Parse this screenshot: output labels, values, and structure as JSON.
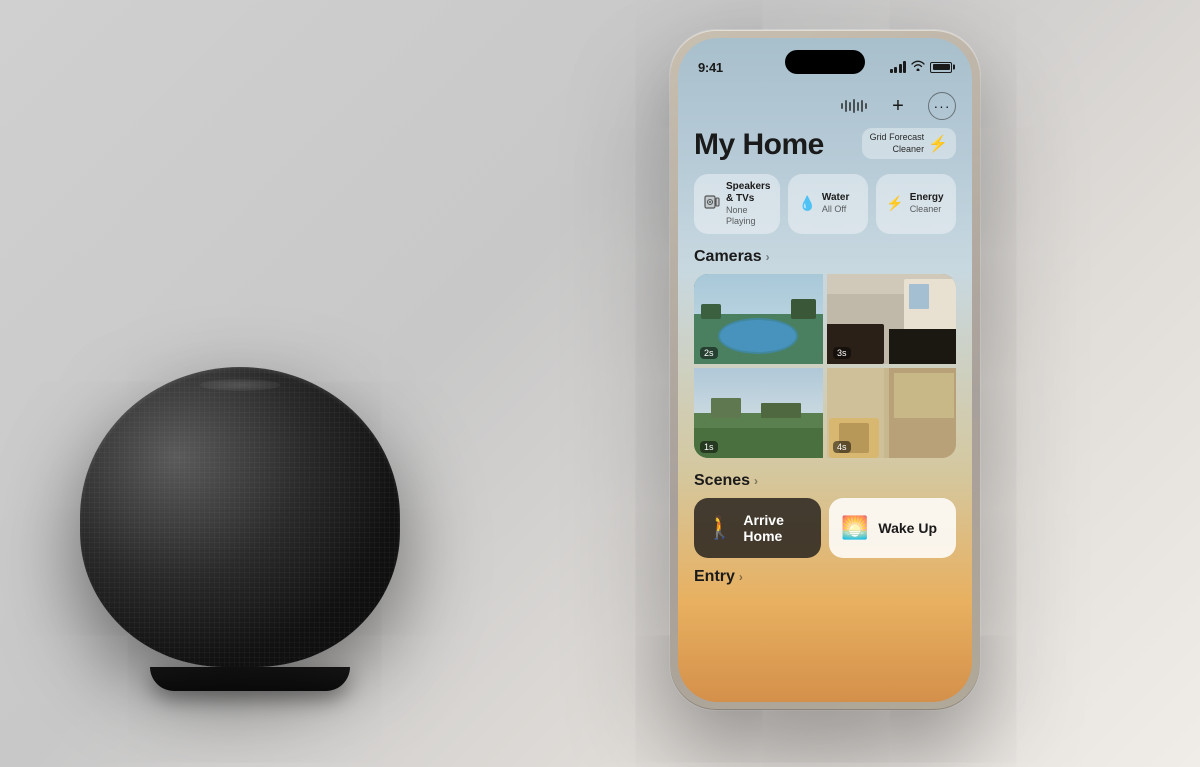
{
  "page": {
    "bg_description": "light gray gradient background"
  },
  "status_bar": {
    "time": "9:41",
    "signal_label": "signal",
    "wifi_label": "wifi",
    "battery_label": "battery"
  },
  "toolbar": {
    "waveform_label": "waveform",
    "add_label": "+",
    "more_label": "···"
  },
  "home": {
    "title": "My Home",
    "grid_forecast_line1": "Grid Forecast",
    "grid_forecast_line2": "Cleaner",
    "grid_forecast_icon": "⚡"
  },
  "pills": [
    {
      "icon": "📺",
      "label": "Speakers & TVs",
      "sublabel": "None Playing"
    },
    {
      "icon": "💧",
      "label": "Water",
      "sublabel": "All Off"
    },
    {
      "icon": "⚡",
      "label": "Energy",
      "sublabel": "Cleaner"
    }
  ],
  "cameras": {
    "section_label": "Cameras",
    "chevron": "›",
    "items": [
      {
        "timer": "2s",
        "type": "pool"
      },
      {
        "timer": "3s",
        "type": "room"
      },
      {
        "timer": "1s",
        "type": "outdoor"
      },
      {
        "timer": "4s",
        "type": "living"
      }
    ]
  },
  "scenes": {
    "section_label": "Scenes",
    "chevron": "›",
    "items": [
      {
        "icon": "🚶",
        "label": "Arrive Home",
        "style": "dark"
      },
      {
        "icon": "🌅",
        "label": "Wake Up",
        "style": "light"
      }
    ]
  },
  "entry": {
    "section_label": "Entry",
    "chevron": "›"
  }
}
